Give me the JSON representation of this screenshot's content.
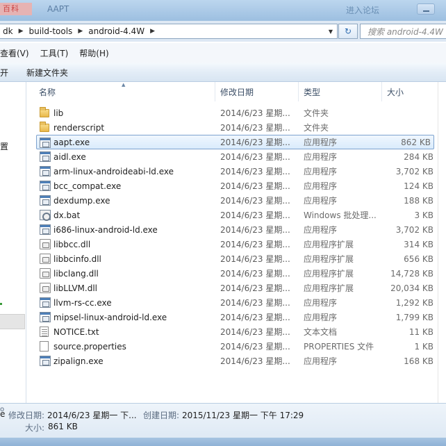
{
  "titlebar": {
    "logo_text": "百科",
    "title": "AAPT",
    "login_text": "进入论坛"
  },
  "address": {
    "crumbs": [
      "dk",
      "build-tools",
      "android-4.4W"
    ],
    "search_placeholder": "搜索 android-4.4W"
  },
  "menu": {
    "items": [
      "查看(V)",
      "工具(T)",
      "帮助(H)"
    ]
  },
  "toolbar": {
    "open_label": "开",
    "new_folder_label": "新建文件夹"
  },
  "navpane": {
    "settings_label": "置"
  },
  "columns": {
    "name": "名称",
    "date": "修改日期",
    "type": "类型",
    "size": "大小"
  },
  "files": [
    {
      "icon": "folder",
      "name": "lib",
      "date": "2014/6/23 星期...",
      "type": "文件夹",
      "size": ""
    },
    {
      "icon": "folder",
      "name": "renderscript",
      "date": "2014/6/23 星期...",
      "type": "文件夹",
      "size": ""
    },
    {
      "icon": "exe",
      "name": "aapt.exe",
      "date": "2014/6/23 星期...",
      "type": "应用程序",
      "size": "862 KB",
      "selected": true
    },
    {
      "icon": "exe",
      "name": "aidl.exe",
      "date": "2014/6/23 星期...",
      "type": "应用程序",
      "size": "284 KB"
    },
    {
      "icon": "exe",
      "name": "arm-linux-androideabi-ld.exe",
      "date": "2014/6/23 星期...",
      "type": "应用程序",
      "size": "3,702 KB"
    },
    {
      "icon": "exe",
      "name": "bcc_compat.exe",
      "date": "2014/6/23 星期...",
      "type": "应用程序",
      "size": "124 KB"
    },
    {
      "icon": "exe",
      "name": "dexdump.exe",
      "date": "2014/6/23 星期...",
      "type": "应用程序",
      "size": "188 KB"
    },
    {
      "icon": "bat",
      "name": "dx.bat",
      "date": "2014/6/23 星期...",
      "type": "Windows 批处理...",
      "size": "3 KB"
    },
    {
      "icon": "exe",
      "name": "i686-linux-android-ld.exe",
      "date": "2014/6/23 星期...",
      "type": "应用程序",
      "size": "3,702 KB"
    },
    {
      "icon": "dll",
      "name": "libbcc.dll",
      "date": "2014/6/23 星期...",
      "type": "应用程序扩展",
      "size": "314 KB"
    },
    {
      "icon": "dll",
      "name": "libbcinfo.dll",
      "date": "2014/6/23 星期...",
      "type": "应用程序扩展",
      "size": "656 KB"
    },
    {
      "icon": "dll",
      "name": "libclang.dll",
      "date": "2014/6/23 星期...",
      "type": "应用程序扩展",
      "size": "14,728 KB"
    },
    {
      "icon": "dll",
      "name": "libLLVM.dll",
      "date": "2014/6/23 星期...",
      "type": "应用程序扩展",
      "size": "20,034 KB"
    },
    {
      "icon": "exe",
      "name": "llvm-rs-cc.exe",
      "date": "2014/6/23 星期...",
      "type": "应用程序",
      "size": "1,292 KB"
    },
    {
      "icon": "exe",
      "name": "mipsel-linux-android-ld.exe",
      "date": "2014/6/23 星期...",
      "type": "应用程序",
      "size": "1,799 KB"
    },
    {
      "icon": "txt",
      "name": "NOTICE.txt",
      "date": "2014/6/23 星期...",
      "type": "文本文档",
      "size": "11 KB"
    },
    {
      "icon": "blank",
      "name": "source.properties",
      "date": "2014/6/23 星期...",
      "type": "PROPERTIES 文件",
      "size": "1 KB"
    },
    {
      "icon": "exe",
      "name": "zipalign.exe",
      "date": "2014/6/23 星期...",
      "type": "应用程序",
      "size": "168 KB"
    }
  ],
  "details": {
    "type_fragment": "e",
    "modified_label": "修改日期:",
    "modified_value": "2014/6/23 星期一 下...",
    "created_label": "创建日期:",
    "created_value": "2015/11/23 星期一 下午 17:29",
    "bullet": "o",
    "size_label": "大小:",
    "size_value": "861 KB"
  },
  "colors": {
    "titlebar": "#a9c8e6",
    "selection_border": "#7da2ce",
    "selection_fill": "#d9ebfc"
  }
}
